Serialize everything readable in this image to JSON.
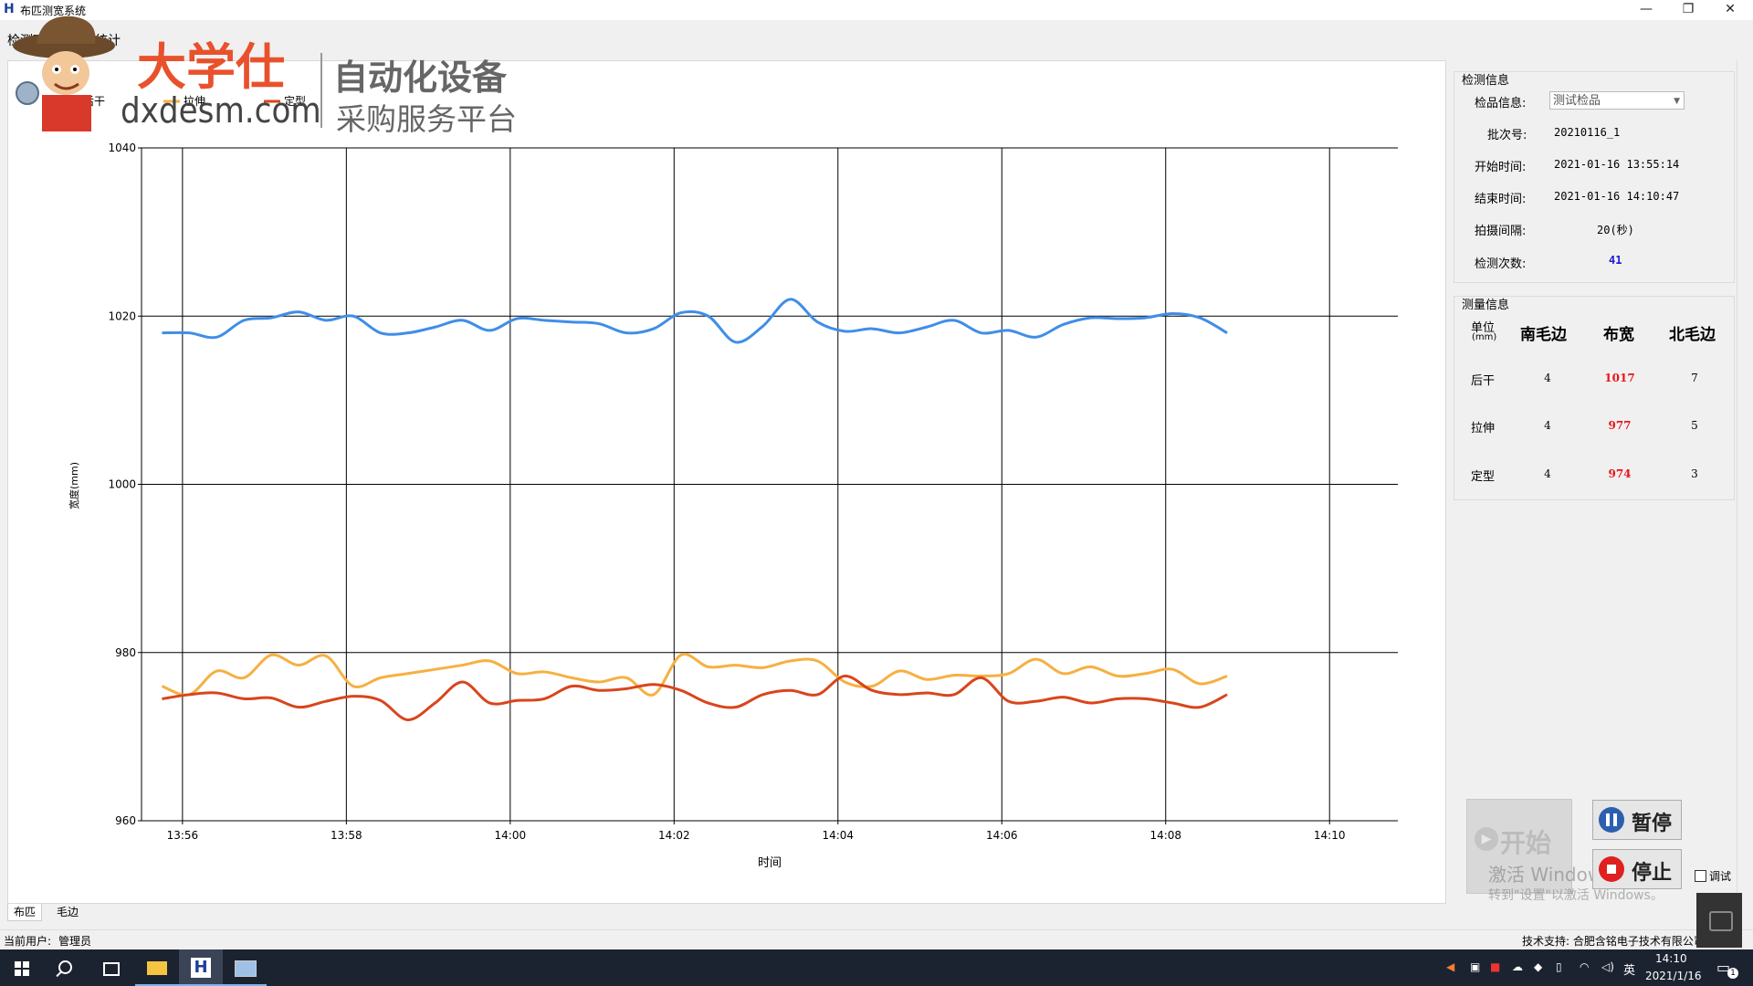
{
  "window": {
    "title": "布匹测宽系统",
    "app_icon_glyph": "H",
    "controls": [
      "—",
      "❐",
      "✕"
    ]
  },
  "menu": {
    "items": [
      "检测面板",
      "查询统计"
    ]
  },
  "watermark": {
    "brand": "大学仕",
    "domain": "dxdesm.com",
    "slogan1": "自动化设备",
    "slogan2": "采购服务平台"
  },
  "chart_data": {
    "type": "line",
    "xlabel": "时间",
    "ylabel": "宽度(mm)",
    "ylim": [
      960,
      1040
    ],
    "yticks": [
      960,
      980,
      1000,
      1020,
      1040
    ],
    "xlim_minutes": [
      "13:55:30",
      "14:10:50"
    ],
    "xticks": [
      "13:56",
      "13:58",
      "14:00",
      "14:02",
      "14:04",
      "14:06",
      "14:08",
      "14:10"
    ],
    "legend_position": "top-left",
    "grid": true,
    "x": [
      "13:55:45",
      "13:56:05",
      "13:56:25",
      "13:56:45",
      "13:57:05",
      "13:57:25",
      "13:57:45",
      "13:58:05",
      "13:58:25",
      "13:58:45",
      "13:59:05",
      "13:59:25",
      "13:59:45",
      "14:00:05",
      "14:00:25",
      "14:00:45",
      "14:01:05",
      "14:01:25",
      "14:01:45",
      "14:02:05",
      "14:02:25",
      "14:02:45",
      "14:03:05",
      "14:03:25",
      "14:03:45",
      "14:04:05",
      "14:04:25",
      "14:04:45",
      "14:05:05",
      "14:05:25",
      "14:05:45",
      "14:06:05",
      "14:06:25",
      "14:06:45",
      "14:07:05",
      "14:07:25",
      "14:07:45",
      "14:08:05",
      "14:08:25",
      "14:08:45",
      "14:09:05",
      "14:09:25",
      "14:09:45",
      "14:10:05",
      "14:10:25"
    ],
    "series": [
      {
        "name": "后干",
        "color": "#3f8ee8",
        "values": [
          1018,
          1018,
          1017.5,
          1019.5,
          1019.8,
          1020.5,
          1019.5,
          1020,
          1018,
          1018,
          1018.7,
          1019.5,
          1018.3,
          1019.7,
          1019.5,
          1019.3,
          1019.1,
          1018,
          1018.5,
          1020.4,
          1020,
          1016.9,
          1018.8,
          1022,
          1019.3,
          1018.2,
          1018.5,
          1018,
          1018.7,
          1019.5,
          1018,
          1018.3,
          1017.5,
          1019,
          1019.8,
          1019.7,
          1019.8,
          1020.3,
          1019.8,
          1018
        ],
        "display_len": 40
      },
      {
        "name": "拉伸",
        "color": "#f6b041",
        "values": [
          976,
          975,
          977.8,
          977,
          979.7,
          978.5,
          979.6,
          976,
          977,
          977.5,
          978,
          978.5,
          979,
          977.5,
          977.7,
          977,
          976.5,
          977,
          975,
          979.7,
          978.3,
          978.5,
          978.2,
          979,
          979,
          976.5,
          976,
          977.8,
          976.8,
          977.3,
          977.2,
          977.5,
          979.2,
          977.5,
          978.3,
          977.2,
          977.5,
          978,
          976.3,
          977.2
        ]
      },
      {
        "name": "定型",
        "color": "#d9451b",
        "values": [
          974.5,
          975,
          975.2,
          974.5,
          974.6,
          973.5,
          974.2,
          974.8,
          974.3,
          972,
          974,
          976.5,
          974,
          974.3,
          974.5,
          976,
          975.5,
          975.7,
          976.2,
          975.5,
          974,
          973.5,
          975,
          975.5,
          975,
          977.2,
          975.5,
          975,
          975.2,
          975,
          977,
          974.2,
          974.2,
          974.7,
          974,
          974.5,
          974.5,
          974,
          973.5,
          975
        ]
      }
    ]
  },
  "bottom_tabs": [
    "布匹",
    "毛边"
  ],
  "inspect": {
    "group_title": "检测信息",
    "product_label": "检品信息:",
    "product_value": "测试检品",
    "batch_label": "批次号:",
    "batch_value": "20210116_1",
    "start_label": "开始时间:",
    "start_value": "2021-01-16 13:55:14",
    "end_label": "结束时间:",
    "end_value": "2021-01-16 14:10:47",
    "interval_label": "拍摄间隔:",
    "interval_value": "20(秒)",
    "count_label": "检测次数:",
    "count_value": "41",
    "count_color": "#1a1ad6"
  },
  "measure": {
    "group_title": "测量信息",
    "unit_label": "单位",
    "unit_sub": "(mm)",
    "headers": [
      "南毛边",
      "布宽",
      "北毛边"
    ],
    "rows": [
      {
        "name": "后干",
        "south": "4",
        "width": "1017",
        "north": "7"
      },
      {
        "name": "拉伸",
        "south": "4",
        "width": "977",
        "north": "5"
      },
      {
        "name": "定型",
        "south": "4",
        "width": "974",
        "north": "3"
      }
    ],
    "width_color": "#e8151b"
  },
  "controls": {
    "start": "开始",
    "pause": "暂停",
    "stop": "停止",
    "debug": "调试",
    "activation_line1": "激活 Windows",
    "activation_line2": "转到\"设置\"以激活 Windows。"
  },
  "status": {
    "user_label": "当前用户:",
    "user_value": "管理员",
    "support": "技术支持: 合肥含铭电子技术有限公司"
  },
  "taskbar": {
    "time": "14:10",
    "date": "2021/1/16",
    "lang": "英",
    "notif_count": "1"
  }
}
